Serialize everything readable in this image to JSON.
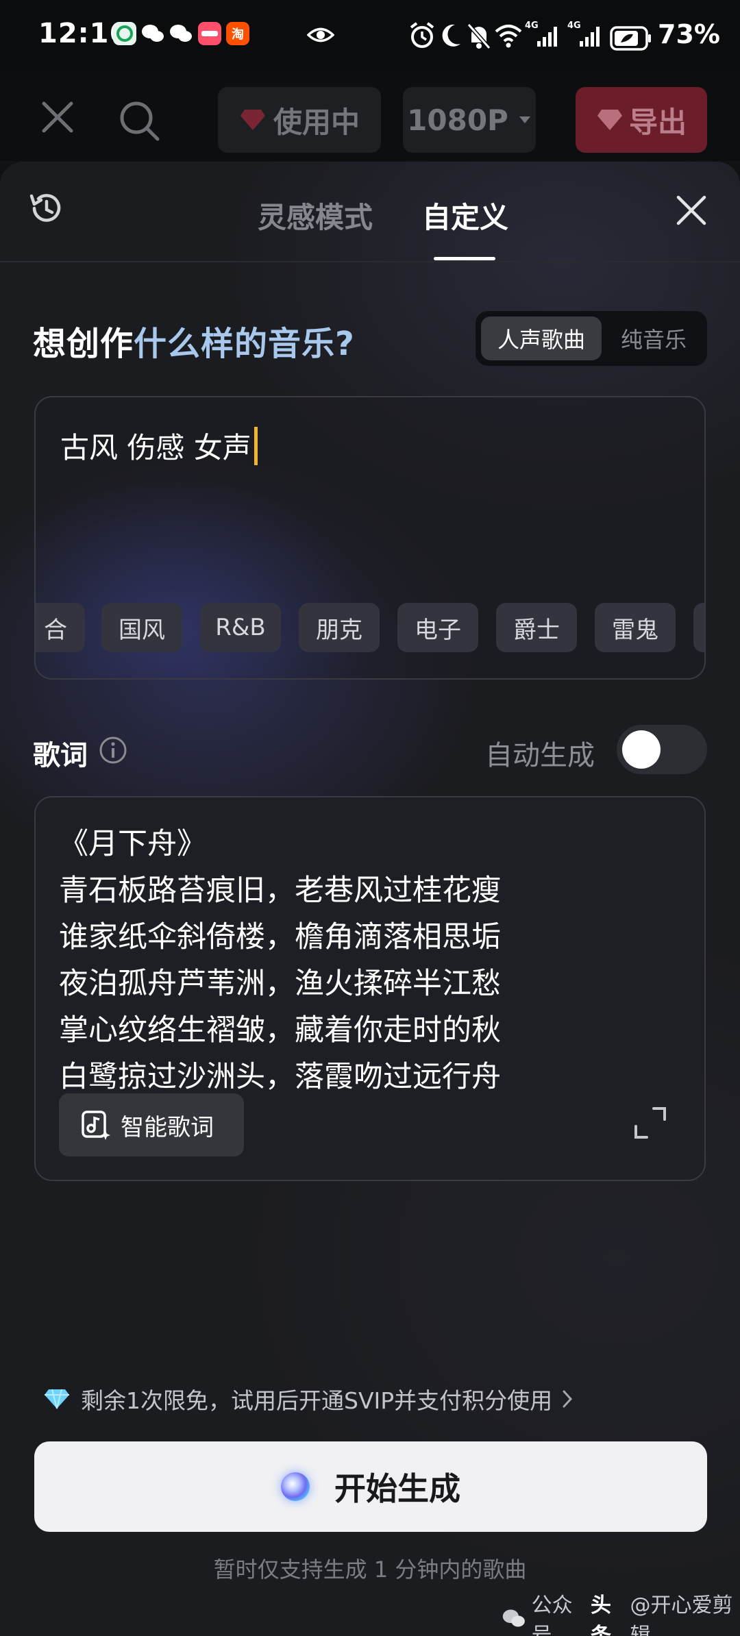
{
  "status_bar": {
    "time": "12:16",
    "battery": "73%",
    "network_1": "4G",
    "network_2": "4G",
    "app_badge_4": "淘"
  },
  "toolbar": {
    "vip_label": "使用中",
    "resolution_label": "1080P",
    "export_label": "导出"
  },
  "sheet": {
    "tabs": [
      {
        "label": "灵感模式",
        "active": false
      },
      {
        "label": "自定义",
        "active": true
      }
    ],
    "question_part1": "想创作",
    "question_part2": "什么样的音乐?",
    "mode_options": [
      {
        "label": "人声歌曲",
        "selected": true
      },
      {
        "label": "纯音乐",
        "selected": false
      }
    ],
    "prompt_value": "古风 伤感 女声",
    "style_chips": [
      "合",
      "国风",
      "R&B",
      "朋克",
      "电子",
      "爵士",
      "雷鬼",
      ""
    ],
    "lyrics_label": "歌词",
    "auto_generate_label": "自动生成",
    "auto_generate_on": false,
    "lyrics_lines": [
      "《月下舟》",
      "青石板路苔痕旧，老巷风过桂花瘦",
      "谁家纸伞斜倚楼，檐角滴落相思垢",
      "夜泊孤舟芦苇洲，渔火揉碎半江愁",
      "掌心纹络生褶皱，藏着你走时的秋",
      "白鹭掠过沙洲头，落霞吻过远行舟"
    ],
    "smart_lyrics_label": "智能歌词",
    "trial_text": "剩余1次限免，试用后开通SVIP并支付积分使用",
    "start_label": "开始生成",
    "note": "暂时仅支持生成 1 分钟内的歌曲"
  },
  "watermark": {
    "text_1": "公众号",
    "text_2": "头条",
    "text_3": "@开心爱剪辑"
  },
  "colors": {
    "accent_blue": "#a9c8ee",
    "export_red": "#6c1d2a",
    "caret_yellow": "#f2b52c",
    "diamond_blue": "#6fd3ff"
  }
}
